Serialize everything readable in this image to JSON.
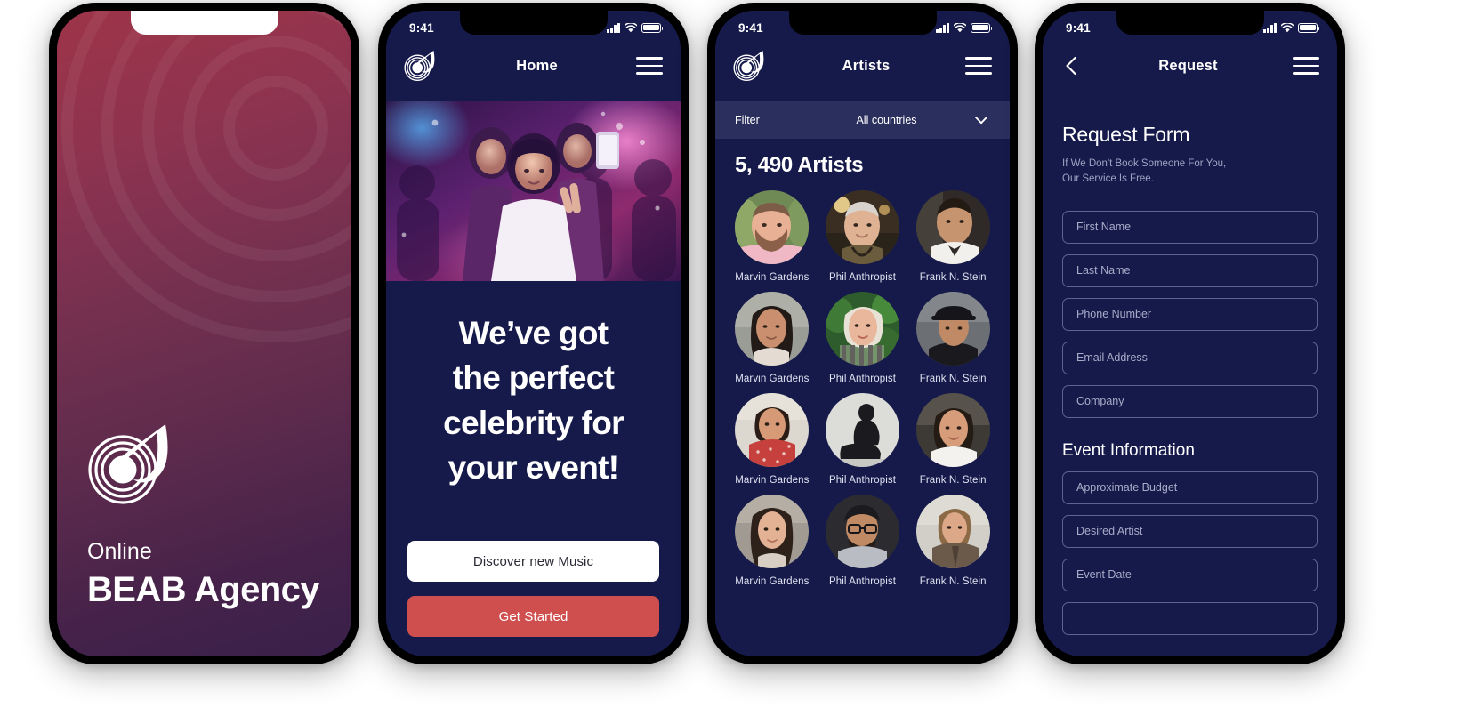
{
  "theme": {
    "navy": "#161a4a",
    "navy_light": "#2b2f5e",
    "accent_red": "#cf4e4e",
    "white": "#ffffff",
    "muted_text": "#9ea3c4",
    "field_border": "#5d6394",
    "splash_gradient_from": "#9e3448",
    "splash_gradient_to": "#39204a"
  },
  "status_bar": {
    "time": "9:41",
    "signal_icon": "cellular-signal-icon",
    "wifi_icon": "wifi-icon",
    "battery_icon": "battery-icon"
  },
  "screens": {
    "splash": {
      "name": "splash-screen",
      "logo_icon": "beab-vinyl-note-logo",
      "subtitle": "Online",
      "title": "BEAB Agency"
    },
    "home": {
      "name": "home-screen",
      "header": {
        "logo_icon": "beab-vinyl-note-logo",
        "title": "Home",
        "menu_icon": "hamburger-menu-icon"
      },
      "hero_alt": "crowd-at-concert-photo",
      "headline": "We’ve got the perfect celebrity for your event!",
      "headline_lines": [
        "We’ve got",
        "the perfect",
        "celebrity for",
        "your event!"
      ],
      "buttons": {
        "secondary": "Discover new Music",
        "primary": "Get Started"
      }
    },
    "artists": {
      "name": "artists-screen",
      "header": {
        "logo_icon": "beab-vinyl-note-logo",
        "title": "Artists",
        "menu_icon": "hamburger-menu-icon"
      },
      "filter": {
        "label": "Filter",
        "value": "All countries",
        "chevron_icon": "chevron-down-icon"
      },
      "count_label": "5, 490 Artists",
      "grid": [
        {
          "name": "Marvin Gardens",
          "avatar": "portrait-bearded-man"
        },
        {
          "name": "Phil Anthropist",
          "avatar": "portrait-man-night"
        },
        {
          "name": "Frank N. Stein",
          "avatar": "portrait-man-white-shirt"
        },
        {
          "name": "Marvin Gardens",
          "avatar": "portrait-woman-long-hair"
        },
        {
          "name": "Phil Anthropist",
          "avatar": "portrait-woman-stripes"
        },
        {
          "name": "Frank N. Stein",
          "avatar": "portrait-man-hat"
        },
        {
          "name": "Marvin Gardens",
          "avatar": "portrait-woman-red-dress"
        },
        {
          "name": "Phil Anthropist",
          "avatar": "portrait-man-seated"
        },
        {
          "name": "Frank N. Stein",
          "avatar": "portrait-woman-white-top"
        },
        {
          "name": "Marvin Gardens",
          "avatar": "portrait-woman-dark-hair"
        },
        {
          "name": "Phil Anthropist",
          "avatar": "portrait-man-glasses"
        },
        {
          "name": "Frank N. Stein",
          "avatar": "portrait-woman-coat"
        }
      ]
    },
    "request": {
      "name": "request-screen",
      "header": {
        "back_icon": "back-chevron-icon",
        "title": "Request",
        "menu_icon": "hamburger-menu-icon"
      },
      "form_title": "Request Form",
      "form_subtitle": "If We Don't Book Someone For You,\nOur Service Is Free.",
      "form_subtitle_lines": [
        "If We Don't Book Someone For You,",
        "Our Service Is Free."
      ],
      "fields": [
        {
          "placeholder": "First Name",
          "value": ""
        },
        {
          "placeholder": "Last Name",
          "value": ""
        },
        {
          "placeholder": "Phone Number",
          "value": ""
        },
        {
          "placeholder": "Email Address",
          "value": ""
        },
        {
          "placeholder": "Company",
          "value": ""
        }
      ],
      "section_title": "Event Information",
      "event_fields": [
        {
          "placeholder": "Approximate Budget",
          "value": ""
        },
        {
          "placeholder": "Desired Artist",
          "value": ""
        },
        {
          "placeholder": "Event Date",
          "value": ""
        }
      ]
    }
  }
}
